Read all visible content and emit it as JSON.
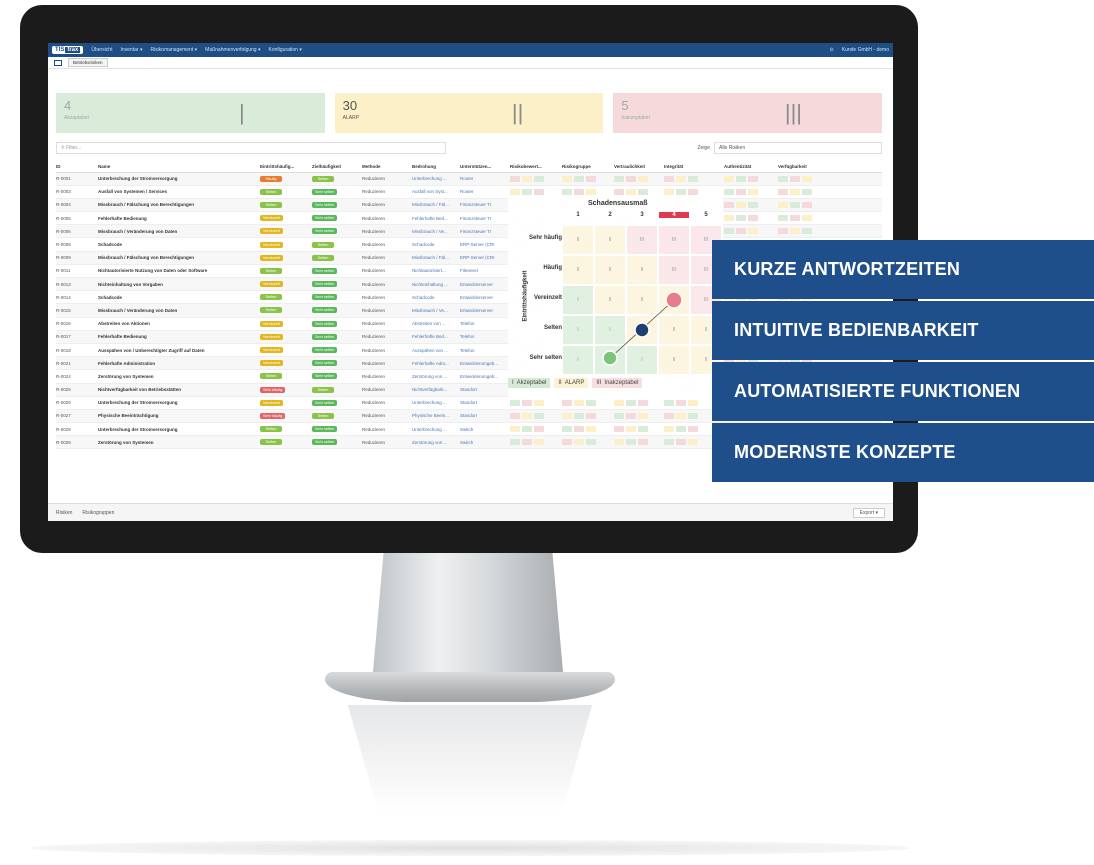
{
  "app": {
    "logo_a": "TIS",
    "logo_b": "trax",
    "nav": [
      "Übersicht",
      "Inventar ▾",
      "Risikomanagement ▾",
      "Maßnahmenverfolgung ▾",
      "Konfiguration ▾"
    ],
    "user": "Kunde GmbH - demo",
    "tab": "Betriebsrisiken"
  },
  "cards": [
    {
      "value": "4",
      "label": "Akzeptabel",
      "symbol": "|"
    },
    {
      "value": "30",
      "label": "ALARP",
      "symbol": "||"
    },
    {
      "value": "5",
      "label": "Inakzeptabel",
      "symbol": "|||"
    }
  ],
  "filter": {
    "placeholder": "Filter...",
    "show_label": "Zeige",
    "show_value": "Alle Risiken"
  },
  "table": {
    "headers": [
      "ID",
      "Name",
      "Eintrittshäufig...",
      "Zielhäufigkeit",
      "Methode",
      "Bedrohung",
      "Unterstützen...",
      "Risikobewert...",
      "Risikogruppe",
      "Vertraulichkeit",
      "Integrität",
      "Authentizität",
      "Verfügbarkeit"
    ],
    "rows": [
      {
        "id": "R-0001",
        "name": "Unterbrechung der Stromversorgung",
        "freq": "Häufig",
        "fcls": "p-haeufig",
        "target": "Selten",
        "tcls": "p-selten",
        "method": "Reduzieren",
        "threat": "Unterbrechung ...",
        "support": "Router"
      },
      {
        "id": "R-0003",
        "name": "Ausfall von Systemen / Services",
        "freq": "Selten",
        "fcls": "p-selten",
        "target": "Sehr selten",
        "tcls": "p-sehrselten",
        "method": "Reduzieren",
        "threat": "Ausfall von Syst...",
        "support": "Router"
      },
      {
        "id": "R-0004",
        "name": "Missbrauch / Fälschung von Berechtigungen",
        "freq": "Selten",
        "fcls": "p-selten",
        "target": "Sehr selten",
        "tcls": "p-sehrselten",
        "method": "Reduzieren",
        "threat": "Missbrauch / Fäl...",
        "support": "Finanzsteuer Tr"
      },
      {
        "id": "R-0005",
        "name": "Fehlerhafte Bedienung",
        "freq": "Vereinzelt",
        "fcls": "p-vereinzelt",
        "target": "Sehr selten",
        "tcls": "p-sehrselten",
        "method": "Reduzieren",
        "threat": "Fehlerhafte Bed...",
        "support": "Finanzsteuer Tr"
      },
      {
        "id": "R-0006",
        "name": "Missbrauch / Veränderung von Daten",
        "freq": "Vereinzelt",
        "fcls": "p-vereinzelt",
        "target": "Sehr selten",
        "tcls": "p-sehrselten",
        "method": "Reduzieren",
        "threat": "Missbrauch / Ve...",
        "support": "Finanzsteuer Tr"
      },
      {
        "id": "R-0008",
        "name": "Schadcode",
        "freq": "Vereinzelt",
        "fcls": "p-vereinzelt",
        "target": "Selten",
        "tcls": "p-selten",
        "method": "Reduzieren",
        "threat": "Schadcode",
        "support": "ERP-Server (CRI"
      },
      {
        "id": "R-0009",
        "name": "Missbrauch / Fälschung von Berechtigungen",
        "freq": "Vereinzelt",
        "fcls": "p-vereinzelt",
        "target": "Selten",
        "tcls": "p-selten",
        "method": "Reduzieren",
        "threat": "Missbrauch / Fäl...",
        "support": "ERP-Server (CRI"
      },
      {
        "id": "R-0011",
        "name": "Nichtautorisierte Nutzung von Daten oder Software",
        "freq": "Selten",
        "fcls": "p-selten",
        "target": "Sehr selten",
        "tcls": "p-sehrselten",
        "method": "Reduzieren",
        "threat": "Nichtautorisiert...",
        "support": "Filesever"
      },
      {
        "id": "R-0013",
        "name": "Nichteinhaltung von Vorgaben",
        "freq": "Vereinzelt",
        "fcls": "p-vereinzelt",
        "target": "Sehr selten",
        "tcls": "p-sehrselten",
        "method": "Reduzieren",
        "threat": "Nichteinhaltung ...",
        "support": "Entwicklerserver"
      },
      {
        "id": "R-0014",
        "name": "Schadcode",
        "freq": "Selten",
        "fcls": "p-selten",
        "target": "Sehr selten",
        "tcls": "p-sehrselten",
        "method": "Reduzieren",
        "threat": "Schadcode",
        "support": "Entwicklerserver"
      },
      {
        "id": "R-0015",
        "name": "Missbrauch / Veränderung von Daten",
        "freq": "Selten",
        "fcls": "p-selten",
        "target": "Sehr selten",
        "tcls": "p-sehrselten",
        "method": "Reduzieren",
        "threat": "Missbrauch / Ve...",
        "support": "Entwicklerserver"
      },
      {
        "id": "R-0016",
        "name": "Abstreiten von Aktionen",
        "freq": "Vereinzelt",
        "fcls": "p-vereinzelt",
        "target": "Sehr selten",
        "tcls": "p-sehrselten",
        "method": "Reduzieren",
        "threat": "Abstreiten von ...",
        "support": "Telefon"
      },
      {
        "id": "R-0017",
        "name": "Fehlerhafte Bedienung",
        "freq": "Vereinzelt",
        "fcls": "p-vereinzelt",
        "target": "Sehr selten",
        "tcls": "p-sehrselten",
        "method": "Reduzieren",
        "threat": "Fehlerhafte Bed...",
        "support": "Telefon"
      },
      {
        "id": "R-0018",
        "name": "Ausspähen von / Unberechtigter Zugriff auf Daten",
        "freq": "Vereinzelt",
        "fcls": "p-vereinzelt",
        "target": "Sehr selten",
        "tcls": "p-sehrselten",
        "method": "Reduzieren",
        "threat": "Ausspähen von ...",
        "support": "Telefon"
      },
      {
        "id": "R-0021",
        "name": "Fehlerhafte Administration",
        "freq": "Vereinzelt",
        "fcls": "p-vereinzelt",
        "target": "Sehr selten",
        "tcls": "p-sehrselten",
        "method": "Reduzieren",
        "threat": "Fehlerhafte Adm...",
        "support": "Entwicklerumgeb..."
      },
      {
        "id": "R-0024",
        "name": "Zerstörung von Systemen",
        "freq": "Selten",
        "fcls": "p-selten",
        "target": "Sehr selten",
        "tcls": "p-sehrselten",
        "method": "Reduzieren",
        "threat": "Zerstörung von ...",
        "support": "Entwicklerumgeb..."
      },
      {
        "id": "R-0025",
        "name": "Nichtverfügbarkeit von Betriebsstätten",
        "freq": "Sehr häufig",
        "fcls": "p-sehrhaeufig",
        "target": "Selten",
        "tcls": "p-selten",
        "method": "Reduzieren",
        "threat": "Nichtverfügbark...",
        "support": "Standort"
      },
      {
        "id": "R-0026",
        "name": "Unterbrechung der Stromversorgung",
        "freq": "Vereinzelt",
        "fcls": "p-vereinzelt",
        "target": "Sehr selten",
        "tcls": "p-sehrselten",
        "method": "Reduzieren",
        "threat": "Unterbrechung ...",
        "support": "Standort"
      },
      {
        "id": "R-0027",
        "name": "Physische Beeinträchtigung",
        "freq": "Sehr häufig",
        "fcls": "p-sehrhaeufig",
        "target": "Selten",
        "tcls": "p-selten",
        "method": "Reduzieren",
        "threat": "Physische Beein...",
        "support": "Standort"
      },
      {
        "id": "R-0028",
        "name": "Unterbrechung der Stromversorgung",
        "freq": "Selten",
        "fcls": "p-selten",
        "target": "Sehr selten",
        "tcls": "p-sehrselten",
        "method": "Reduzieren",
        "threat": "Unterbrechung ...",
        "support": "Switch"
      },
      {
        "id": "R-0029",
        "name": "Zerstörung von Systemen",
        "freq": "Selten",
        "fcls": "p-selten",
        "target": "Sehr selten",
        "tcls": "p-sehrselten",
        "method": "Reduzieren",
        "threat": "Zerstörung von ...",
        "support": "Switch"
      }
    ]
  },
  "footer": {
    "tab1": "Risiken",
    "tab2": "Risikogruppen",
    "export": "Export ▾"
  },
  "matrix": {
    "title": "Schadensausmaß",
    "axis": "Eintrittshäufigkeit",
    "cols": [
      "1",
      "2",
      "3",
      "4",
      "5"
    ],
    "rows": [
      "Sehr häufig",
      "Häufig",
      "Vereinzelt",
      "Selten",
      "Sehr selten"
    ],
    "legend": [
      {
        "code": "I",
        "label": "Akzeptabel"
      },
      {
        "code": "II",
        "label": "ALARP"
      },
      {
        "code": "III",
        "label": "Inakzeptabel"
      }
    ]
  },
  "features": [
    "KURZE ANTWORTZEITEN",
    "INTUITIVE BEDIENBARKEIT",
    "AUTOMATISIERTE FUNKTIONEN",
    "MODERNSTE KONZEPTE"
  ]
}
